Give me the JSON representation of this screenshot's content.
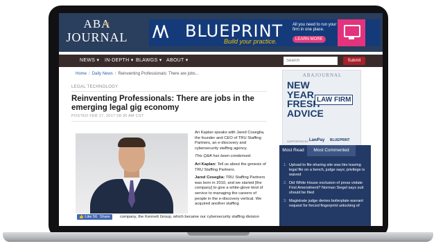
{
  "header": {
    "logo_line1": "ABA",
    "logo_line2": "JOURNAL",
    "ad": {
      "brand": "BLUEPRINT",
      "tagline": "Build your practice.",
      "copy": "All you need to run your firm in one place.",
      "cta": "LEARN MORE"
    }
  },
  "nav": {
    "items": [
      "NEWS",
      "IN-DEPTH",
      "BLAWGS",
      "ABOUT"
    ],
    "search_placeholder": "Search",
    "submit_label": "Submit"
  },
  "breadcrumb": [
    "Home",
    "Daily News",
    "Reinventing Professionals: There are jobs..."
  ],
  "article": {
    "section": "LEGAL TECHNOLOGY",
    "title": "Reinventing Professionals: There are jobs in the emerging legal gig economy",
    "posted": "POSTED FEB 17, 2017 08:30 AM CST",
    "intro": "Ari Kaplan speaks with Jared Coseglia, the founder and CEO of TRU Staffing Partners, an e-discovery and cybersecurity staffing agency.",
    "condensed": "This Q&A has been condensed.",
    "q1_speaker": "Ari Kaplan:",
    "q1_text": "Tell us about the genesis of TRU Staffing Partners.",
    "a1_speaker": "Jared Coseglia:",
    "a1_text": "TRU Staffing Partners was born in 2010, and we started [the company] to give a white-glove kind of service to managing the careers of people in the e-discovery vertical. We acquired another staffing",
    "a1_tail": "company, the Kennett Group, which became our cybersecurity staffing division",
    "like_label": "Like 56",
    "share_label": "Share"
  },
  "sidebar_ad": {
    "brand": "ABAJOURNAL",
    "headline": [
      "NEW",
      "YEAR.",
      "FRESH",
      "ADVICE"
    ],
    "badge": "LAW FIRM",
    "supported": "SUPPORTED BY",
    "sponsor1": "LawPay",
    "sponsor2": "BLUEPRINT"
  },
  "sidebar_tabs": {
    "tab1": "Most Read",
    "tab2": "Most Commented",
    "items": [
      "Upload to file-sharing site was like leaving legal file on a bench, judge says; privilege is waived",
      "Did White House exclusion of press violate First Amendment? Norman Siegel says suit should be filed",
      "Magistrate judge denies boilerplate warrant request for forced fingerprint unlocking of"
    ]
  },
  "colors": {
    "header_bg": "#2a3e5d",
    "nav_bg": "#3a2b2b",
    "submit_bg": "#a8202a",
    "link": "#2a62a8",
    "sidebar_bg": "#243a66",
    "ad_pink": "#e3337c"
  }
}
